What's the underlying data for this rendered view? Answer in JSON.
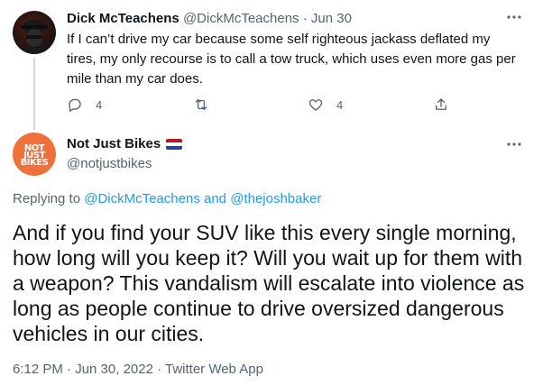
{
  "reply_tweet": {
    "name": "Dick McTeachens",
    "handle": "@DickMcTeachens",
    "separator": "·",
    "date": "Jun 30",
    "text": "If I can’t drive my car because some self righteous jackass deflated my tires, my only recourse is to call a tow truck, which uses even more gas per mile than my car does.",
    "actions": {
      "reply_count": "4",
      "retweet_count": "",
      "like_count": "4"
    }
  },
  "main_tweet": {
    "name": "Not Just Bikes",
    "handle": "@notjustbikes",
    "avatar_text": [
      "NOT",
      "JUST",
      "BIKES"
    ],
    "replying_prefix": "Replying to",
    "replying_user1": "@DickMcTeachens",
    "replying_and": "and",
    "replying_user2": "@thejoshbaker",
    "text": "And if you find your SUV like this every single morning, how long will you keep it? Will you wait up for them with a weapon? This vandalism will escalate into violence as long as people continue to drive oversized dangerous vehicles in our cities.",
    "meta": "6:12 PM · Jun 30, 2022 · Twitter Web App"
  },
  "colors": {
    "link": "#1d9bf0",
    "secondary": "#536471",
    "avatar_orange": "#f0703c",
    "flag": [
      "#ae1c28",
      "#ffffff",
      "#21468b"
    ]
  },
  "icons": [
    "more-icon",
    "reply-icon",
    "retweet-icon",
    "like-icon",
    "share-icon",
    "netherlands-flag-icon"
  ]
}
